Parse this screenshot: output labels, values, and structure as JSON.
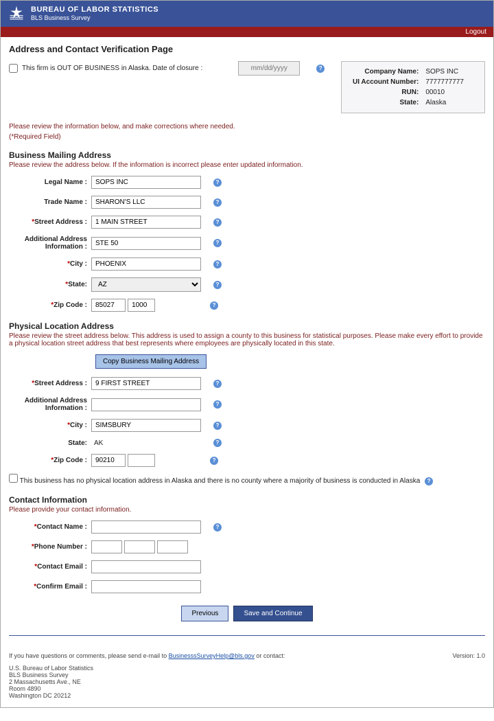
{
  "header": {
    "title": "BUREAU OF LABOR STATISTICS",
    "subtitle": "BLS Business Survey",
    "logout": "Logout"
  },
  "page_title": "Address and Contact Verification Page",
  "out_of_business": {
    "label": "This firm is OUT OF BUSINESS in Alaska. Date of closure :",
    "placeholder": "mm/dd/yyyy"
  },
  "company": {
    "name_label": "Company Name:",
    "name": "SOPS INC",
    "ui_label": "UI Account Number:",
    "ui": "7777777777",
    "run_label": "RUN:",
    "run": "00010",
    "state_label": "State:",
    "state": "Alaska"
  },
  "instructions": "Please review the information below, and make corrections where needed.",
  "required_note": "(*Required Field)",
  "mailing": {
    "title": "Business Mailing Address",
    "sub": "Please review the address below. If the information is incorrect please enter updated information.",
    "legal_name": {
      "label": "Legal Name :",
      "value": "SOPS INC"
    },
    "trade_name": {
      "label": "Trade Name :",
      "value": "SHARON'S LLC"
    },
    "street": {
      "label": "Street Address :",
      "value": "1 MAIN STREET"
    },
    "addl": {
      "label1": "Additional Address",
      "label2": "Information :",
      "value": "STE 50"
    },
    "city": {
      "label": "City :",
      "value": "PHOENIX"
    },
    "state": {
      "label": "State:",
      "value": "AZ"
    },
    "zip": {
      "label": "Zip Code :",
      "v1": "85027",
      "v2": "1000"
    }
  },
  "physical": {
    "title": "Physical Location Address",
    "sub": "Please review the street address below. This address is used to assign a county to this business for statistical purposes. Please make every effort to provide a physical location street address that best represents where employees are physically located in this state.",
    "copy_btn": "Copy Business Mailing Address",
    "street": {
      "label": "Street Address :",
      "value": "9 FIRST STREET"
    },
    "addl": {
      "label1": "Additional Address",
      "label2": "Information :",
      "value": ""
    },
    "city": {
      "label": "City :",
      "value": "SIMSBURY"
    },
    "state": {
      "label": "State:",
      "value": "AK"
    },
    "zip": {
      "label": "Zip Code :",
      "v1": "90210",
      "v2": ""
    },
    "no_physical": "This business has no physical location address in Alaska and there is no county where a majority of business is conducted in Alaska"
  },
  "contact": {
    "title": "Contact Information",
    "sub": "Please provide your contact information.",
    "name": "Contact Name :",
    "phone": "Phone Number :",
    "email": "Contact Email :",
    "confirm": "Confirm Email :"
  },
  "buttons": {
    "previous": "Previous",
    "save": "Save and Continue"
  },
  "footer": {
    "line1": "If you have questions or comments, please send e-mail to ",
    "email": "BusinesssSurveyHelp@bls.gov",
    "line1b": " or contact:",
    "version": "Version: 1.0",
    "addr1": "U.S. Bureau of Labor Statistics",
    "addr2": "BLS Business Survey",
    "addr3": "2 Massachusetts Ave., NE",
    "addr4": "Room 4890",
    "addr5": "Washington DC 20212"
  }
}
